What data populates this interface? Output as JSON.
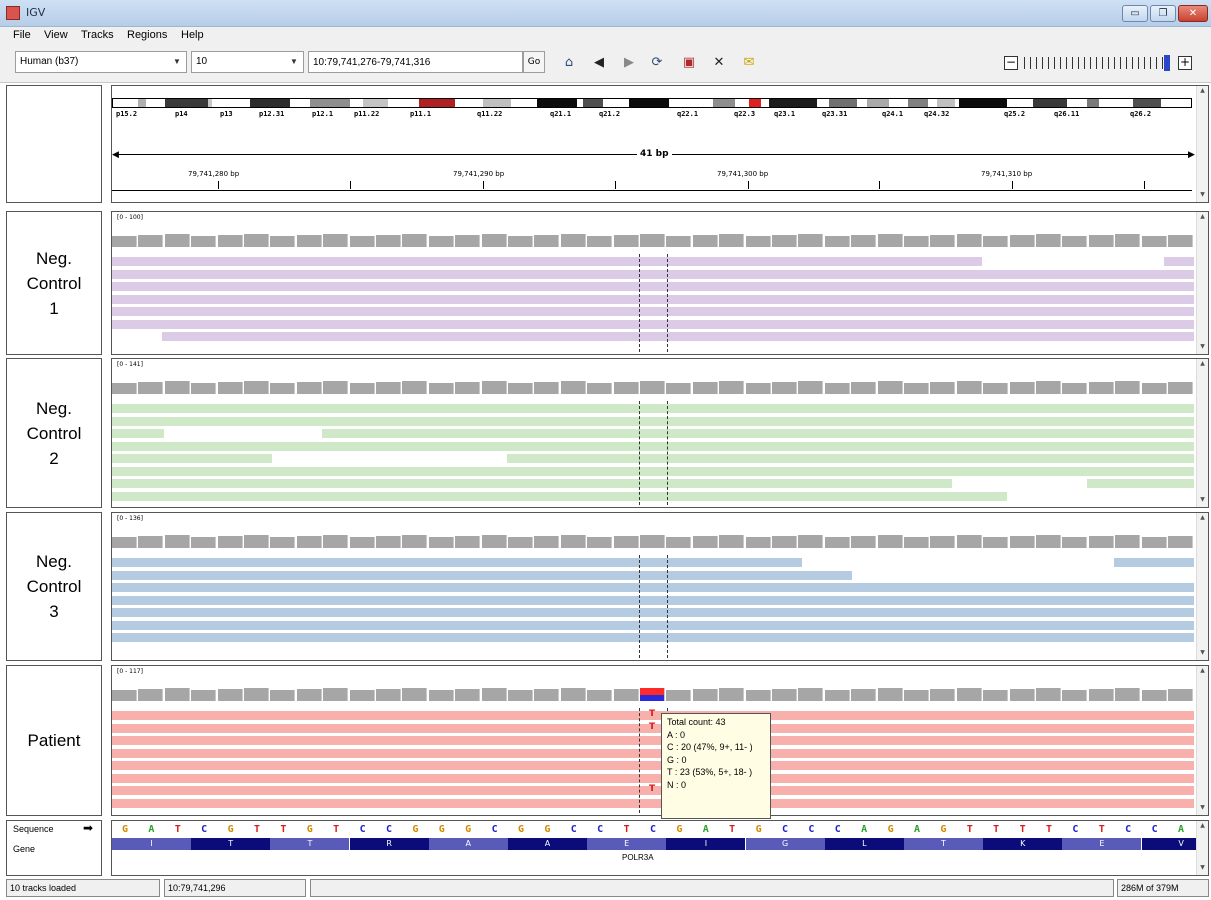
{
  "window": {
    "title": "IGV",
    "min_symbol": "▭",
    "max_symbol": "❐",
    "close_symbol": "✕"
  },
  "menu": [
    "File",
    "View",
    "Tracks",
    "Regions",
    "Help"
  ],
  "toolbar": {
    "genome": "Human (b37)",
    "chromosome": "10",
    "locus": "10:79,741,276-79,741,316",
    "go_label": "Go",
    "zoom_minus": "−",
    "zoom_plus": "+"
  },
  "ruler": {
    "width_label": "41 bp",
    "positions": [
      "79,741,280 bp",
      "79,741,290 bp",
      "79,741,300 bp",
      "79,741,310 bp"
    ]
  },
  "ideogram_bands": [
    "p15.2",
    "p14",
    "p13",
    "p12.31",
    "p12.1",
    "p11.22",
    "p11.1",
    "q11.22",
    "q21.1",
    "q21.2",
    "q22.1",
    "q22.3",
    "q23.1",
    "q23.31",
    "q24.1",
    "q24.32",
    "q25.2",
    "q26.11",
    "q26.2"
  ],
  "samples": [
    {
      "name": "Neg.\nControl\n1",
      "range": "[0 - 100]",
      "read_color": "#dccbe6"
    },
    {
      "name": "Neg.\nControl\n2",
      "range": "[0 - 141]",
      "read_color": "#cfe8c8"
    },
    {
      "name": "Neg.\nControl\n3",
      "range": "[0 - 136]",
      "read_color": "#b4cbe2"
    },
    {
      "name": "Patient",
      "range": "[0 - 117]",
      "read_color": "#f7b0ac"
    }
  ],
  "variant": {
    "allele": "T"
  },
  "tooltip": {
    "total": "Total count: 43",
    "a": "A : 0",
    "c": "C : 20 (47%, 9+, 11- )",
    "g": "G : 0",
    "t": "T : 23 (53%, 5+, 18- )",
    "n": "N : 0"
  },
  "sequence": {
    "label": "Sequence",
    "arrow": "➡",
    "bases": [
      "G",
      "A",
      "T",
      "C",
      "G",
      "T",
      "T",
      "G",
      "T",
      "C",
      "C",
      "G",
      "G",
      "G",
      "C",
      "G",
      "G",
      "C",
      "C",
      "T",
      "C",
      "G",
      "A",
      "T",
      "G",
      "C",
      "C",
      "C",
      "A",
      "G",
      "A",
      "G",
      "T",
      "T",
      "T",
      "T",
      "C",
      "T",
      "C",
      "C",
      "A"
    ]
  },
  "gene": {
    "label": "Gene",
    "name": "POLR3A",
    "amino_acids": [
      "I",
      "T",
      "T",
      "R",
      "A",
      "A",
      "E",
      "I",
      "G",
      "L",
      "T",
      "K",
      "E",
      "V"
    ]
  },
  "status": {
    "tracks": "10 tracks loaded",
    "position": "10:79,741,296",
    "memory": "286M of 379M"
  }
}
